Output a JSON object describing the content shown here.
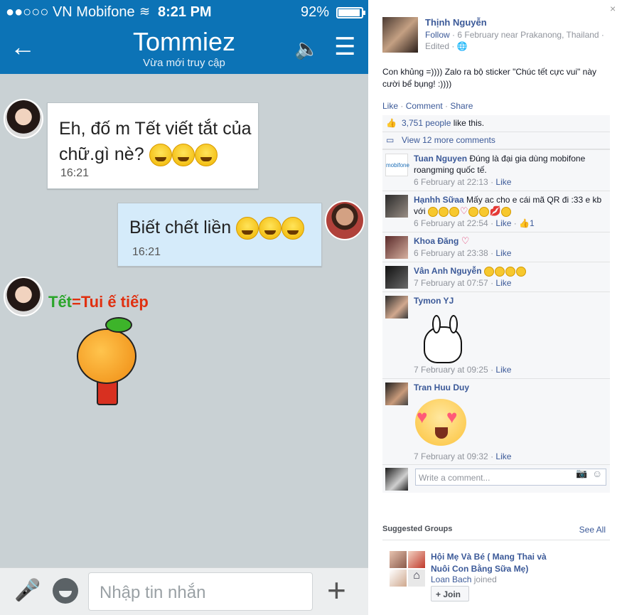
{
  "phone": {
    "status": {
      "carrier": "●●○○○ VN Mobifone",
      "wifi_icon": "wifi-icon",
      "time": "8:21 PM",
      "battery": "92%"
    },
    "header": {
      "back_icon": "←",
      "title": "Tommiez",
      "subtitle": "Vừa mới truy cập",
      "speaker_icon": "🔈",
      "menu_icon": "☰"
    },
    "messages": [
      {
        "sender": "other",
        "text": "Eh, đố m Tết viết tắt của chữ.gì nè?",
        "time": "16:21"
      },
      {
        "sender": "me",
        "text": "Biết chết liền",
        "time": "16:21"
      },
      {
        "sender": "other",
        "sticker_caption_left": "Tết",
        "sticker_caption_mid": "=",
        "sticker_caption_right": "Tui ế tiếp"
      }
    ],
    "input": {
      "placeholder": "Nhập tin nhắn",
      "mic_icon": "🎤",
      "plus_icon": "+"
    }
  },
  "facebook": {
    "close_icon": "×",
    "post": {
      "author": "Thịnh Nguyễn",
      "follow": "Follow",
      "meta": " · 6 February near Prakanong, Thailand · Edited · ",
      "text": "Con khủng =)))) Zalo ra bộ sticker \"Chúc tết cực vui\" này cười bể bụng! :))))",
      "actions": {
        "like": "Like",
        "comment": "Comment",
        "share": "Share",
        "sep": " · "
      }
    },
    "likes": {
      "count": "3,751 people",
      "suffix": " like this."
    },
    "view_more": "View 12 more comments",
    "comments": [
      {
        "name": "Tuan Nguyen",
        "text": " Đúng là đại gia dùng mobifone roangming quốc tế.",
        "time": "6 February at 22:13",
        "like": "Like",
        "likes": ""
      },
      {
        "name": "Hạnhh Sữaa",
        "text": " Mấy ac cho e cái mã QR đi :33 e kb với",
        "time": "6 February at 22:54",
        "like": "Like",
        "likes": "1"
      },
      {
        "name": "Khoa Đăng",
        "text": "",
        "time": "6 February at 23:38",
        "like": "Like",
        "likes": ""
      },
      {
        "name": "Vân Anh Nguyễn",
        "text": "",
        "time": "7 February at 07:57",
        "like": "Like",
        "likes": ""
      },
      {
        "name": "Tymon YJ",
        "text": "",
        "time": "7 February at 09:25",
        "like": "Like",
        "likes": ""
      },
      {
        "name": "Tran Huu Duy",
        "text": "",
        "time": "7 February at 09:32",
        "like": "Like",
        "likes": ""
      }
    ],
    "mobifone_logo": "mobifone",
    "write_placeholder": "Write a comment...",
    "suggested": {
      "header": "Suggested Groups",
      "see_all": "See All",
      "group_name": "Hội Mẹ Và Bé ( Mang Thai và Nuôi Con Bằng Sữa Mẹ)",
      "joined_name": "Loan Bach",
      "joined_suffix": " joined",
      "join": "Join"
    }
  }
}
